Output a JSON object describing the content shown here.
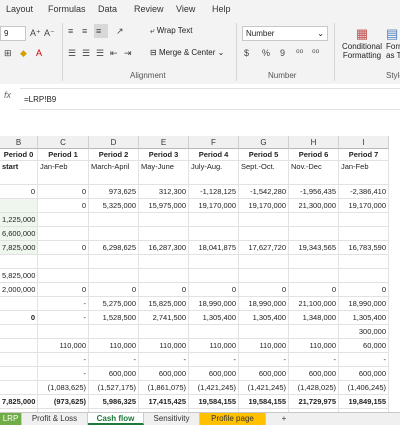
{
  "menu": [
    "Layout",
    "Formulas",
    "Data",
    "Review",
    "View",
    "Help"
  ],
  "ribbon": {
    "font_size": "9",
    "wrap_text": "Wrap Text",
    "merge_center": "Merge & Center",
    "number_format": "Number",
    "currency_symbol": "$",
    "percent_symbol": "%",
    "comma_symbol": "9",
    "decrease_decimal": "⁰⁰",
    "increase_decimal": "⁰⁰",
    "conditional_formatting": "Conditional Formatting",
    "format_as_table": "Format as Table",
    "cell_styles": "Styles",
    "alignment_label": "Alignment",
    "number_label": "Number",
    "styles_label": "Style"
  },
  "formula_bar": {
    "fx_label": "fx",
    "formula": "=LRP!B9"
  },
  "columns": [
    "B",
    "C",
    "D",
    "E",
    "F",
    "G",
    "H",
    "I"
  ],
  "rows": [
    [
      "Period 0",
      "Period 1",
      "Period 2",
      "Period 3",
      "Period 4",
      "Period 5",
      "Period 6",
      "Period 7"
    ],
    [
      "start",
      "Jan-Feb",
      "March-April",
      "May-June",
      "July-Aug.",
      "Sept.-Oct.",
      "Nov.-Dec",
      "Jan-Feb"
    ],
    [
      "0",
      "0",
      "973,625",
      "312,300",
      "-1,128,125",
      "-1,542,280",
      "-1,956,435",
      "-2,386,410"
    ],
    [
      "",
      "0",
      "5,325,000",
      "15,975,000",
      "19,170,000",
      "19,170,000",
      "21,300,000",
      "19,170,000"
    ],
    [
      "1,225,000",
      "",
      "",
      "",
      "",
      "",
      "",
      ""
    ],
    [
      "6,600,000",
      "",
      "",
      "",
      "",
      "",
      "",
      ""
    ],
    [
      "7,825,000",
      "0",
      "6,298,625",
      "16,287,300",
      "18,041,875",
      "17,627,720",
      "19,343,565",
      "16,783,590"
    ],
    [
      "",
      "",
      "",
      "",
      "",
      "",
      "",
      ""
    ],
    [
      "5,825,000",
      "",
      "",
      "",
      "",
      "",
      "",
      ""
    ],
    [
      "2,000,000",
      "0",
      "0",
      "0",
      "0",
      "0",
      "0",
      "0"
    ],
    [
      "",
      "-",
      "5,275,000",
      "15,825,000",
      "18,990,000",
      "18,990,000",
      "21,100,000",
      "18,990,000"
    ],
    [
      "0",
      "-",
      "1,528,500",
      "2,741,500",
      "1,305,400",
      "1,305,400",
      "1,348,000",
      "1,305,400"
    ],
    [
      "",
      "",
      "",
      "",
      "",
      "",
      "",
      "300,000"
    ],
    [
      "",
      "110,000",
      "110,000",
      "110,000",
      "110,000",
      "110,000",
      "110,000",
      "60,000"
    ],
    [
      "",
      "-",
      "-",
      "-",
      "-",
      "-",
      "-",
      "-"
    ],
    [
      "",
      "-",
      "600,000",
      "600,000",
      "600,000",
      "600,000",
      "600,000",
      "600,000"
    ],
    [
      "",
      "(1,083,625)",
      "(1,527,175)",
      "(1,861,075)",
      "(1,421,245)",
      "(1,421,245)",
      "(1,428,025)",
      "(1,406,245)"
    ],
    [
      "7,825,000",
      "(973,625)",
      "5,986,325",
      "17,415,425",
      "19,584,155",
      "19,584,155",
      "21,729,975",
      "19,849,155"
    ],
    [
      "0",
      "973,625",
      "312,300",
      "-1,128,125",
      "-1,542,280",
      "-1,956,435",
      "-2,386,410",
      "-3,065,565"
    ]
  ],
  "tabs": [
    "LRP",
    "Profit & Loss",
    "Cash flow",
    "Sensitivity",
    "Profile page"
  ],
  "add_sheet": "+"
}
